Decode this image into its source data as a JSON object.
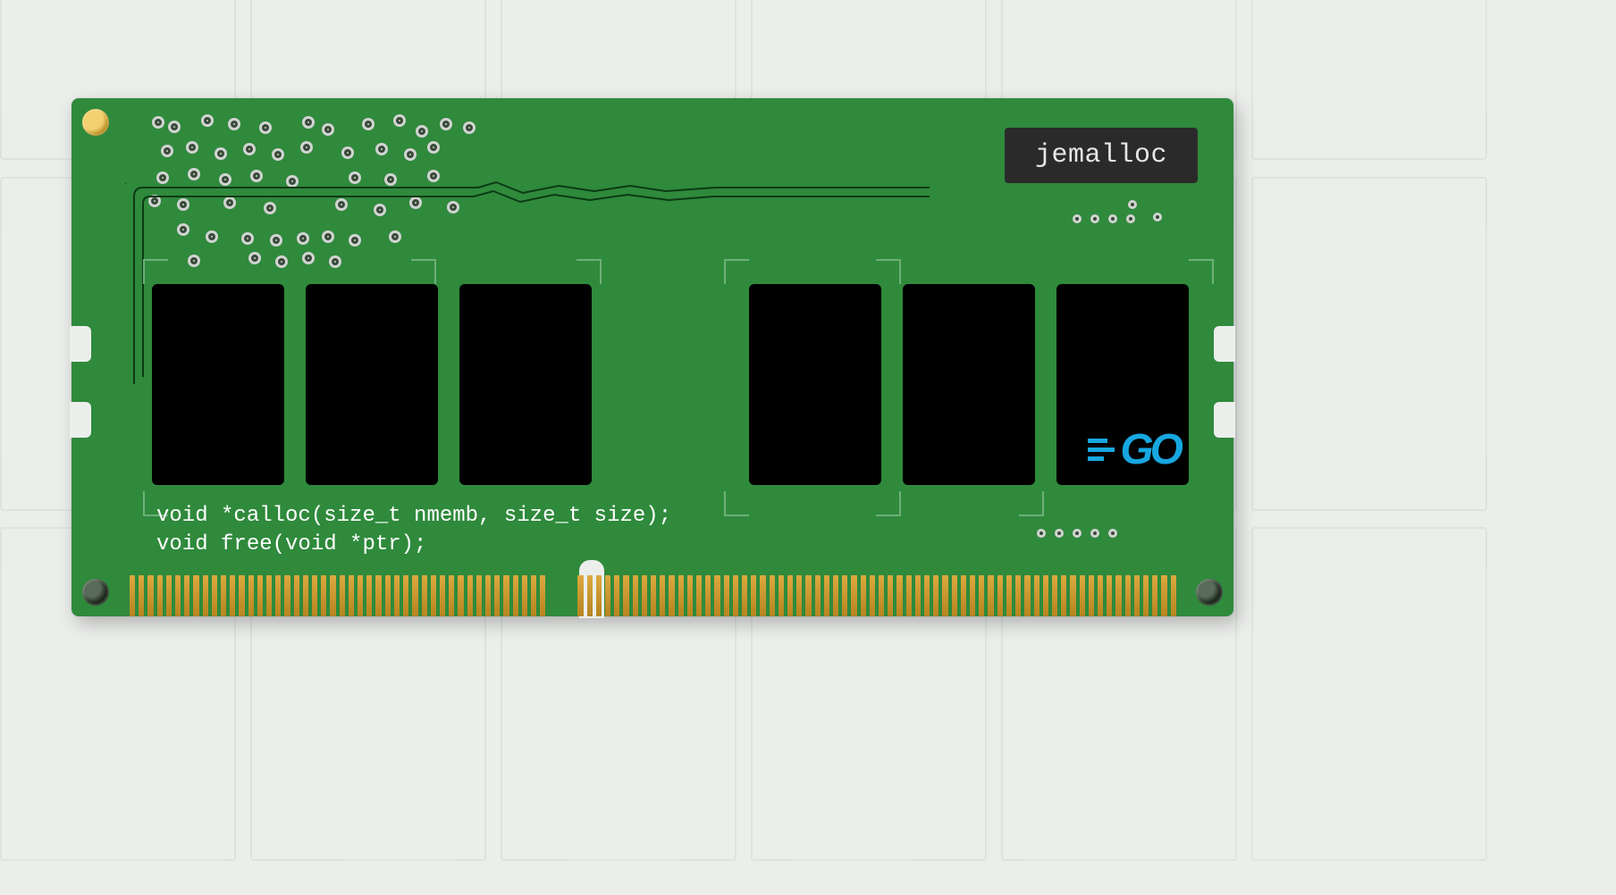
{
  "label": {
    "text": "jemalloc"
  },
  "code": {
    "line1": "void *calloc(size_t nmemb, size_t size);",
    "line2": "void free(void *ptr);"
  },
  "logo": {
    "text": "GO"
  },
  "colors": {
    "pcb": "#2f8a3c",
    "chip": "#000000",
    "label_bg": "#2a2a2a",
    "label_fg": "#e6e6e6",
    "code_fg": "#ffffff",
    "gold": "#dca93f",
    "accent": "#17a7e0"
  }
}
